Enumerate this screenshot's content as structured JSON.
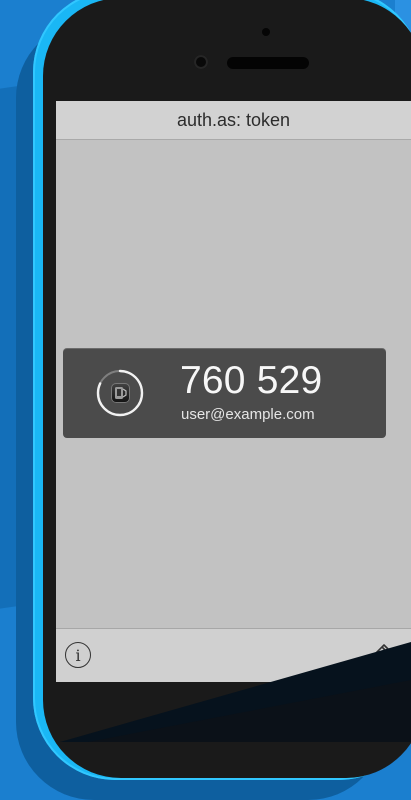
{
  "app": {
    "title": "auth.as: token"
  },
  "token": {
    "code": "760 529",
    "account": "user@example.com",
    "countdown_progress": 0.82
  },
  "icons": {
    "app": "app-icon",
    "timer": "timer-ring-icon",
    "info": "info-icon",
    "edit": "pencil-icon"
  },
  "colors": {
    "phone": "#1ab7f5",
    "background": "#1b7fcf",
    "screen": "#c2c2c2",
    "card": "#4b4b4b"
  }
}
